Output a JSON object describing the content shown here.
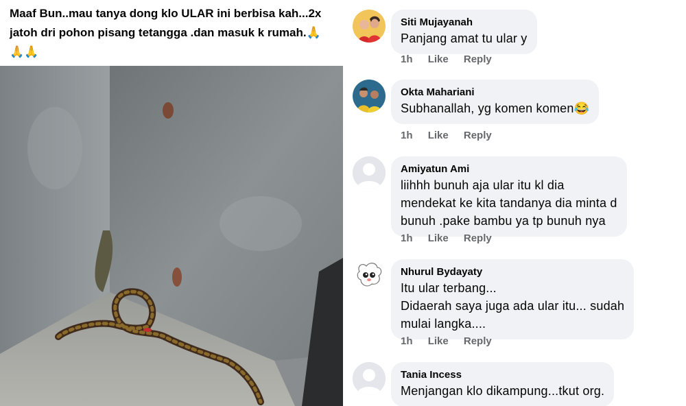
{
  "post": {
    "text_lines": [
      "Maaf Bun..mau tanya dong klo ULAR ini berbisa kah...2x",
      "jatoh dri pohon pisang tetangga .dan masuk k rumah."
    ],
    "emojis": [
      "🙏",
      "🙏",
      "🙏"
    ]
  },
  "comments": [
    {
      "author": "Siti Mujayanah",
      "lines": [
        "Panjang amat tu ular y"
      ],
      "time": "1h",
      "like": "Like",
      "reply": "Reply"
    },
    {
      "author": "Okta Mahariani",
      "lines": [
        "Subhanallah, yg komen komen😂"
      ],
      "time": "1h",
      "like": "Like",
      "reply": "Reply"
    },
    {
      "author": "Amiyatun Ami",
      "lines": [
        "liihhh  bunuh  aja  ular  itu  kl dia",
        "mendekat ke kita tandanya dia minta d",
        "bunuh  .pake  bambu  ya  tp  bunuh  nya"
      ],
      "time": "1h",
      "like": "Like",
      "reply": "Reply"
    },
    {
      "author": "Nhurul Bydayaty",
      "lines": [
        "Itu ular terbang...",
        "Didaerah saya juga ada ular itu... sudah",
        "mulai langka...."
      ],
      "time": "1h",
      "like": "Like",
      "reply": "Reply"
    },
    {
      "author": "Tania Incess",
      "lines": [
        "Menjangan klo dikampung...tkut org."
      ]
    }
  ]
}
